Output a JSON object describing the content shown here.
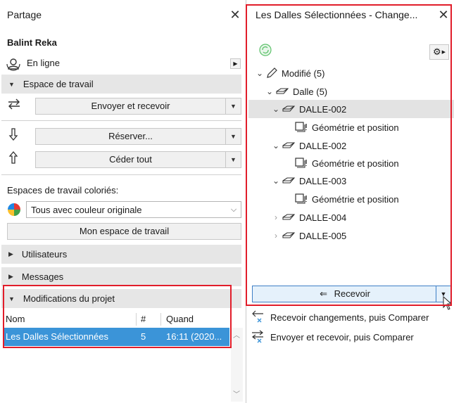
{
  "left": {
    "title": "Partage",
    "user": "Balint Reka",
    "status": "En ligne",
    "workspace_section": "Espace de travail",
    "send_receive": "Envoyer et recevoir",
    "reserve": "Réserver...",
    "release_all": "Céder tout",
    "colored_label": "Espaces de travail coloriés:",
    "color_option": "Tous avec couleur originale",
    "my_workspace": "Mon espace de travail",
    "users_section": "Utilisateurs",
    "messages_section": "Messages",
    "changes_section": "Modifications du projet",
    "table": {
      "headers": [
        "Nom",
        "#",
        "Quand"
      ],
      "rows": [
        {
          "name": "Les Dalles Sélectionnées",
          "count": "5",
          "when": "16:11 (2020..."
        }
      ]
    }
  },
  "right": {
    "title": "Les Dalles Sélectionnées - Change...",
    "tree": [
      {
        "label": "Modifié (5)"
      },
      {
        "label": "Dalle (5)"
      },
      {
        "label": "DALLE-002"
      },
      {
        "label": "Géométrie et position"
      },
      {
        "label": "DALLE-002"
      },
      {
        "label": "Géométrie et position"
      },
      {
        "label": "DALLE-003"
      },
      {
        "label": "Géométrie et position"
      },
      {
        "label": "DALLE-004"
      },
      {
        "label": "DALLE-005"
      }
    ],
    "receive_button": "Recevoir",
    "menu": {
      "receive_compare": "Recevoir changements, puis Comparer",
      "send_receive_compare": "Envoyer et recevoir, puis Comparer"
    }
  },
  "colors": {
    "highlight_red": "#e11d2a",
    "selection_blue": "#3b94d8",
    "section_gray": "#e6e6e6",
    "button_blue_border": "#3e7fc6"
  }
}
